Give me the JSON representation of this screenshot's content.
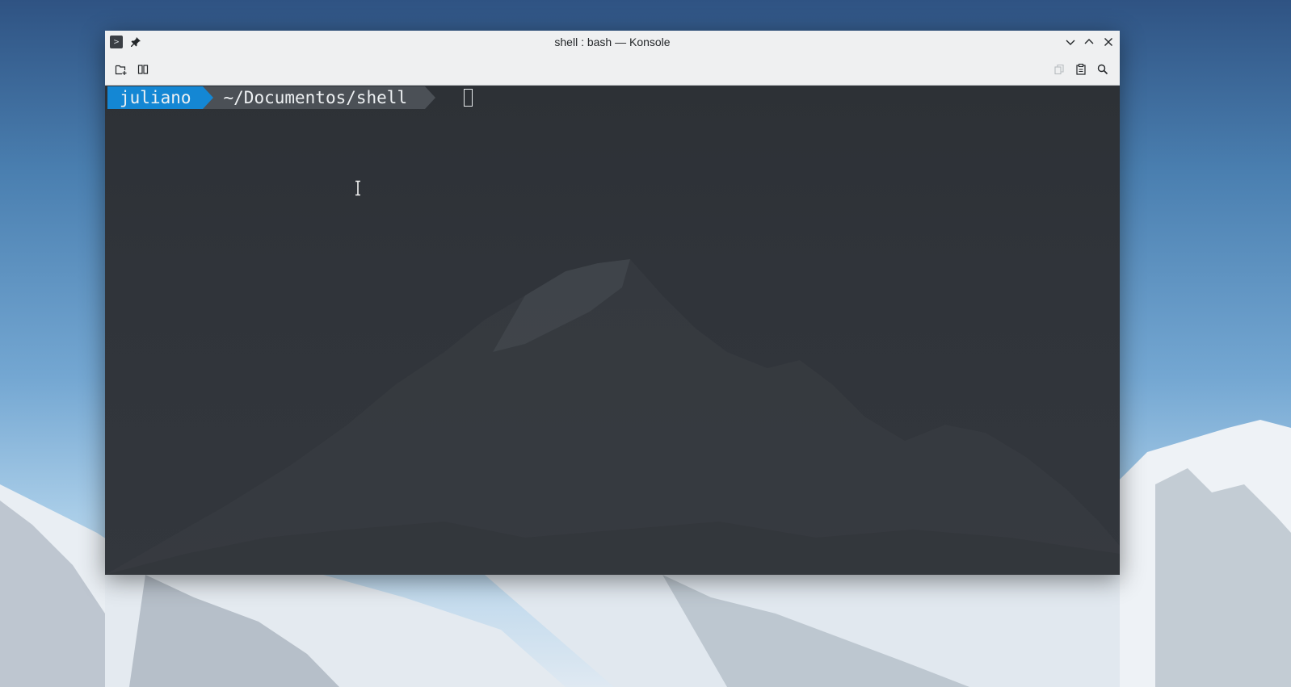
{
  "window": {
    "title": "shell : bash — Konsole",
    "app_icon_glyph": ">"
  },
  "titlebar_buttons": [
    "minimize",
    "maximize",
    "close"
  ],
  "toolbar": {
    "left": [
      "new-tab",
      "split-view"
    ],
    "right": [
      "copy",
      "paste",
      "find"
    ]
  },
  "terminal": {
    "prompt_user": "juliano",
    "prompt_path": "~/Documentos/shell",
    "colors": {
      "user_segment": "#1487d4",
      "path_segment": "#4b5056",
      "background": "#30343a"
    }
  }
}
